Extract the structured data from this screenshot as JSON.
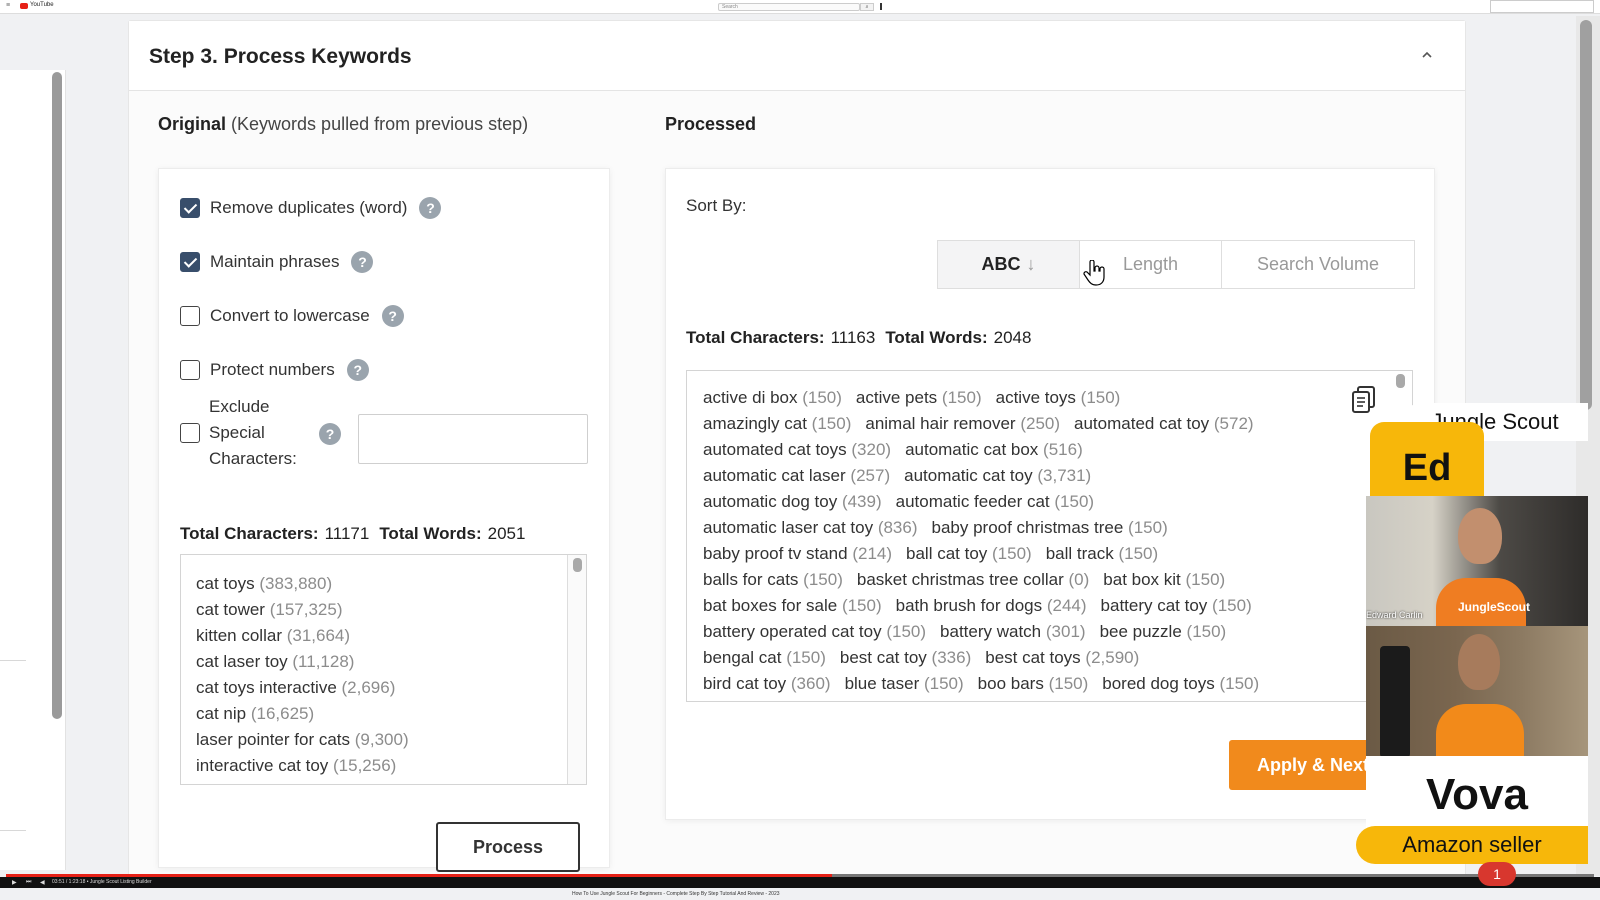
{
  "browser": {
    "site_name": "YouTube",
    "search_placeholder": "Search"
  },
  "card": {
    "title": "Step 3. Process Keywords"
  },
  "original": {
    "heading": "Original",
    "heading_sub": "(Keywords pulled from previous step)",
    "options": [
      {
        "label": "Remove duplicates (word)",
        "checked": true
      },
      {
        "label": "Maintain phrases",
        "checked": true
      },
      {
        "label": "Convert to lowercase",
        "checked": false
      },
      {
        "label": "Protect numbers",
        "checked": false
      }
    ],
    "exclude_label_lines": [
      "Exclude",
      "Special",
      "Characters:"
    ],
    "exclude_value": "",
    "totals": {
      "chars_label": "Total Characters:",
      "chars_value": "11171",
      "words_label": "Total Words:",
      "words_value": "2051"
    },
    "keywords": [
      {
        "term": "cat toys",
        "volume": "(383,880)"
      },
      {
        "term": "cat tower",
        "volume": "(157,325)"
      },
      {
        "term": "kitten collar",
        "volume": "(31,664)"
      },
      {
        "term": "cat laser toy",
        "volume": "(11,128)"
      },
      {
        "term": "cat toys interactive",
        "volume": "(2,696)"
      },
      {
        "term": "cat nip",
        "volume": "(16,625)"
      },
      {
        "term": "laser pointer for cats",
        "volume": "(9,300)"
      },
      {
        "term": "interactive cat toy",
        "volume": "(15,256)"
      }
    ],
    "process_button": "Process"
  },
  "processed": {
    "heading": "Processed",
    "sort_label": "Sort By:",
    "sort_options": [
      "ABC",
      "Length",
      "Search Volume"
    ],
    "sort_active": "ABC",
    "sort_arrow": "↓",
    "totals": {
      "chars_label": "Total Characters:",
      "chars_value": "11163",
      "words_label": "Total Words:",
      "words_value": "2048"
    },
    "lines": [
      [
        {
          "term": "active di box",
          "volume": "(150)"
        },
        {
          "term": "active pets",
          "volume": "(150)"
        },
        {
          "term": "active toys",
          "volume": "(150)"
        }
      ],
      [
        {
          "term": "amazingly cat",
          "volume": "(150)"
        },
        {
          "term": "animal hair remover",
          "volume": "(250)"
        },
        {
          "term": "automated cat toy",
          "volume": "(572)"
        }
      ],
      [
        {
          "term": "automated cat toys",
          "volume": "(320)"
        },
        {
          "term": "automatic cat box",
          "volume": "(516)"
        }
      ],
      [
        {
          "term": "automatic cat laser",
          "volume": "(257)"
        },
        {
          "term": "automatic cat toy",
          "volume": "(3,731)"
        }
      ],
      [
        {
          "term": "automatic dog toy",
          "volume": "(439)"
        },
        {
          "term": "automatic feeder cat",
          "volume": "(150)"
        }
      ],
      [
        {
          "term": "automatic laser cat toy",
          "volume": "(836)"
        },
        {
          "term": "baby proof christmas tree",
          "volume": "(150)"
        }
      ],
      [
        {
          "term": "baby proof tv stand",
          "volume": "(214)"
        },
        {
          "term": "ball cat toy",
          "volume": "(150)"
        },
        {
          "term": "ball track",
          "volume": "(150)"
        }
      ],
      [
        {
          "term": "balls for cats",
          "volume": "(150)"
        },
        {
          "term": "basket christmas tree collar",
          "volume": "(0)"
        },
        {
          "term": "bat box kit",
          "volume": "(150)"
        }
      ],
      [
        {
          "term": "bat boxes for sale",
          "volume": "(150)"
        },
        {
          "term": "bath brush for dogs",
          "volume": "(244)"
        },
        {
          "term": "battery cat toy",
          "volume": "(150)"
        }
      ],
      [
        {
          "term": "battery operated cat toy",
          "volume": "(150)"
        },
        {
          "term": "battery watch",
          "volume": "(301)"
        },
        {
          "term": "bee puzzle",
          "volume": "(150)"
        }
      ],
      [
        {
          "term": "bengal cat",
          "volume": "(150)"
        },
        {
          "term": "best cat toy",
          "volume": "(336)"
        },
        {
          "term": "best cat toys",
          "volume": "(2,590)"
        }
      ],
      [
        {
          "term": "bird cat toy",
          "volume": "(360)"
        },
        {
          "term": "blue taser",
          "volume": "(150)"
        },
        {
          "term": "boo bars",
          "volume": "(150)"
        },
        {
          "term": "bored dog toys",
          "volume": "(150)"
        }
      ]
    ],
    "apply_button": "Apply & Next"
  },
  "overlay": {
    "brand": "Jungle Scout",
    "host_name": "Ed",
    "host_fullname": "Edward Carlin",
    "host_shirt": "JungleScout",
    "guest_name": "Vova",
    "guest_role": "Amazon seller"
  },
  "player": {
    "time": "03:51 / 1:23:18",
    "chapter": "Jungle Scout Listing Builder",
    "progress": 0.52,
    "video_title": "How To Use Jungle Scout For Beginners - Complete Step By Step Tutorial And Review - 2023",
    "notification_count": "1"
  },
  "colors": {
    "accent_orange": "#f18a1c",
    "tag_yellow": "#f7b70a",
    "checkbox_checked": "#384e6b",
    "youtube_red": "#e62117"
  }
}
